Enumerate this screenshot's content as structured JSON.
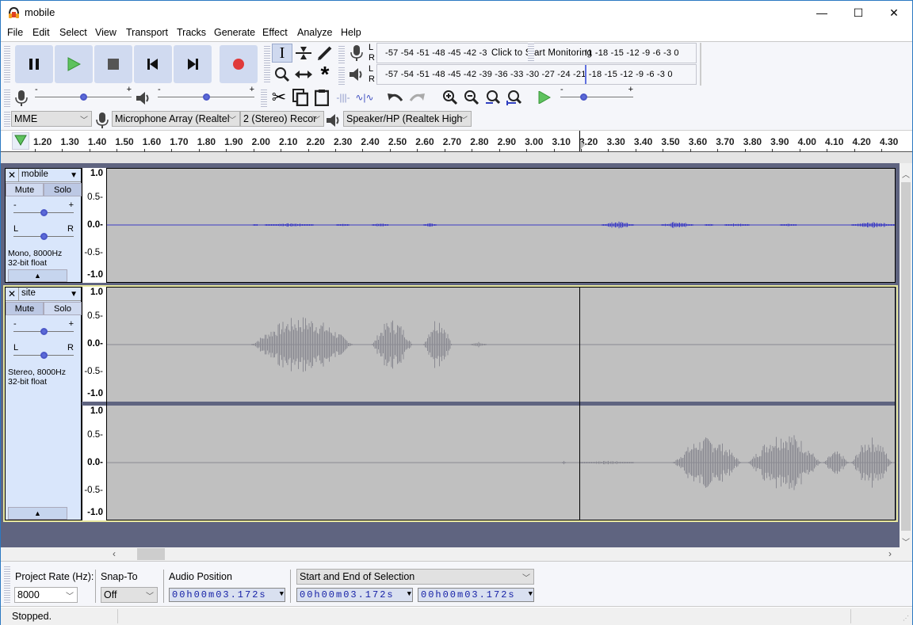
{
  "window": {
    "title": "mobile",
    "minimize": "—",
    "maximize": "☐",
    "close": "✕"
  },
  "menu": [
    "File",
    "Edit",
    "Select",
    "View",
    "Transport",
    "Tracks",
    "Generate",
    "Effect",
    "Analyze",
    "Help"
  ],
  "transport": {
    "pause": "pause-icon",
    "play": "play-icon",
    "stop": "stop-icon",
    "skip_start": "skip-to-start-icon",
    "skip_end": "skip-to-end-icon",
    "record": "record-icon",
    "colors": {
      "play": "#4cb04c",
      "record": "#e03a3a"
    }
  },
  "meters": {
    "record_scale": "-57 -54 -51 -48 -45 -42 -3",
    "record_prompt": "Click to Start Monitoring",
    "record_scale_right": "!1 -18 -15 -12  -9  -6  -3  0",
    "playback_scale": "-57 -54 -51 -48 -45 -42 -39 -36 -33 -30 -27 -24 -21 -18 -15 -12  -9  -6  -3  0",
    "L": "L",
    "R": "R"
  },
  "mixer": {
    "minus": "-",
    "plus": "+",
    "record_volume": 0.5,
    "playback_volume": 0.5,
    "play_at_speed": 0.3
  },
  "devices": {
    "host": "MME",
    "input": "Microphone Array (Realtel",
    "channels": "2 (Stereo) Recor",
    "output": "Speaker/HP (Realtek High"
  },
  "ruler": {
    "ticks": [
      "1.20",
      "1.30",
      "1.40",
      "1.50",
      "1.60",
      "1.70",
      "1.80",
      "1.90",
      "2.00",
      "2.10",
      "2.20",
      "2.30",
      "2.40",
      "2.50",
      "2.60",
      "2.70",
      "2.80",
      "2.90",
      "3.00",
      "3.10",
      "3.20",
      "3.30",
      "3.40",
      "3.50",
      "3.60",
      "3.70",
      "3.80",
      "3.90",
      "4.00",
      "4.10",
      "4.20",
      "4.30"
    ],
    "cursor_time": "3.172"
  },
  "tracks": [
    {
      "name": "mobile",
      "mute": "Mute",
      "solo": "Solo",
      "info1": "Mono, 8000Hz",
      "info2": "32-bit float",
      "gain": 0.5,
      "pan": 0.5,
      "gain_minus": "-",
      "gain_plus": "+",
      "pan_l": "L",
      "pan_r": "R",
      "scale": [
        "1.0",
        "0.5-",
        "0.0-",
        "-0.5-",
        "-1.0"
      ],
      "wave_color": "#3c3cc4"
    },
    {
      "name": "site",
      "mute": "Mute",
      "solo": "Solo",
      "info1": "Stereo, 8000Hz",
      "info2": "32-bit float",
      "gain": 0.5,
      "pan": 0.5,
      "gain_minus": "-",
      "gain_plus": "+",
      "pan_l": "L",
      "pan_r": "R",
      "scale": [
        "1.0",
        "0.5-",
        "0.0-",
        "-0.5-",
        "-1.0"
      ],
      "scale2": [
        "1.0",
        "0.5-",
        "0.0-",
        "-0.5-",
        "-1.0"
      ],
      "wave_color": "#8a8a92"
    }
  ],
  "selection_toolbar": {
    "project_rate_label": "Project Rate (Hz):",
    "project_rate": "8000",
    "snap_label": "Snap-To",
    "snap_value": "Off",
    "audio_position_label": "Audio Position",
    "audio_position": "00h00m03.172s",
    "selection_mode": "Start and End of Selection",
    "selection_start": "00h00m03.172s",
    "selection_end": "00h00m03.172s"
  },
  "status": {
    "text": "Stopped."
  }
}
